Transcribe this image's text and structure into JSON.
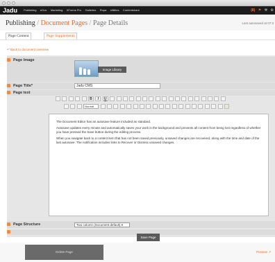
{
  "app": {
    "brand": "Jadu",
    "nav_items": [
      "Publishing",
      "eGov",
      "Marketing",
      "XForms Pro",
      "Galleries",
      "Rupa",
      "Utilities",
      "Contentshare"
    ],
    "notification_count": "(8)"
  },
  "header": {
    "breadcrumb_root": "Publishing",
    "breadcrumb_separator": "/",
    "breadcrumb_parent": "Document Pages",
    "breadcrumb_current": "Page Details",
    "autosave": "Last autosaved at 07:3"
  },
  "tabs": [
    {
      "label": "Page Content",
      "active": true
    },
    {
      "label": "Page Supplements",
      "active": false
    }
  ],
  "back_link": "Back to document overview",
  "form": {
    "page_image_label": "Page Image",
    "image_library_button": "Image Library",
    "page_title_label": "Page Title*",
    "page_title_value": "Jadu CMS",
    "page_text_label": "Page text",
    "toolbar_format_value": "Normal",
    "page_structure_label": "Page Structure",
    "page_structure_value": "Two column (Document default) ▾",
    "save_button": "Save Page"
  },
  "editor": {
    "paragraphs": [
      "The Document Editor has an autosave feature included as standard.",
      "Autosave updates every minute and automatically saves your work in the background and prevents all content from being lost regardless of whether you have pressed the Save button during the editing process.",
      "When you navigate back to a content item that has not been saved previously, unsaved changes are recovered, along with the time and date of the last autosave. The notification includes links to Recover or Dismiss unsaved changes."
    ]
  },
  "footer": {
    "delete_button": "Delete Page",
    "preview_link": "Preview ↗"
  },
  "colors": {
    "accent": "#e86a2a",
    "marker": "#f08a3c",
    "nav_bg": "#1c1c1c",
    "panel_bg": "#e6e6e6"
  }
}
